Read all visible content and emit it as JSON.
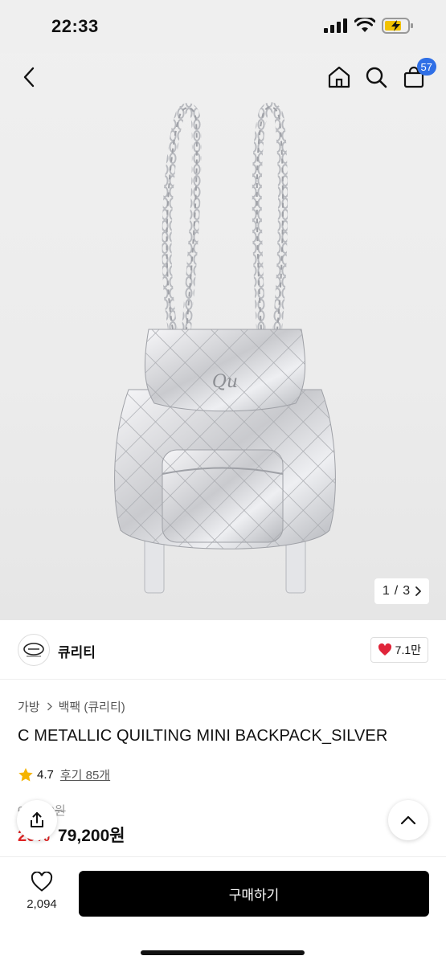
{
  "status": {
    "time": "22:33"
  },
  "nav": {
    "cart_count": "57"
  },
  "gallery": {
    "current": "1",
    "separator": "/",
    "total": "3"
  },
  "brand": {
    "name": "큐리티",
    "likes": "7.1만"
  },
  "breadcrumb": [
    "가방",
    "백팩 (큐리티)"
  ],
  "product": {
    "title": "C METALLIC QUILTING MINI BACKPACK_SILVER",
    "rating": "4.7",
    "reviews": "후기 85개",
    "original_price": "99,000원",
    "discount": "20%",
    "sale_price": "79,200원"
  },
  "bottom": {
    "wish_count": "2,094",
    "buy_label": "구매하기"
  },
  "colors": {
    "accent_badge": "#2f6fe6",
    "discount": "#e02424",
    "heart": "#e0253a",
    "star": "#f5b400"
  },
  "icons": [
    "back-icon",
    "home-icon",
    "search-icon",
    "cart-icon",
    "chevron-right-icon",
    "heart-icon",
    "star-icon",
    "share-icon",
    "chevron-up-icon",
    "heart-outline-icon"
  ]
}
